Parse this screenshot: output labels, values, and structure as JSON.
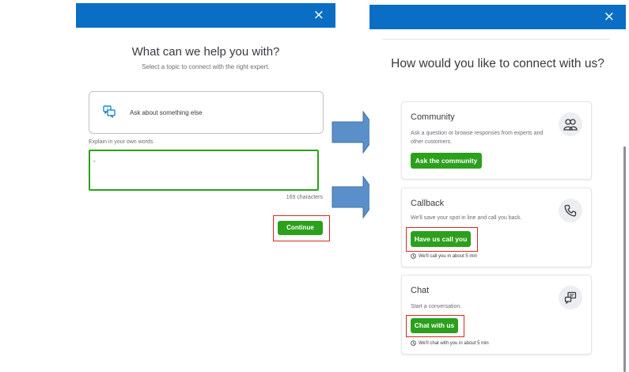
{
  "left": {
    "close_glyph": "×",
    "title": "What can we help you with?",
    "subtitle": "Select a topic to connect with the right expert.",
    "topic": {
      "label": "Ask about something else",
      "icon": "chat-bubbles-icon"
    },
    "explain_label": "Explain in your own words",
    "explain_value": "-",
    "char_count": "169 characters",
    "continue_label": "Continue"
  },
  "right": {
    "close_glyph": "×",
    "title": "How would you like to connect with us?",
    "options": [
      {
        "title": "Community",
        "description": "Ask a question or browse responses from experts and other customers.",
        "button": "Ask the community",
        "icon": "community-people-icon"
      },
      {
        "title": "Callback",
        "description": "We'll save your spot in line and call you back.",
        "button": "Have us call you",
        "wait": "We'll call you in about 5 min",
        "icon": "phone-icon"
      },
      {
        "title": "Chat",
        "description": "Start a conversation.",
        "button": "Chat with us",
        "wait": "We'll chat with you in about 5 min",
        "icon": "chat-icon"
      }
    ]
  },
  "colors": {
    "header_blue": "#0b6ec5",
    "action_green": "#2ca01c",
    "highlight_red": "#d52b1e",
    "arrow_blue": "#5b8fc9"
  }
}
